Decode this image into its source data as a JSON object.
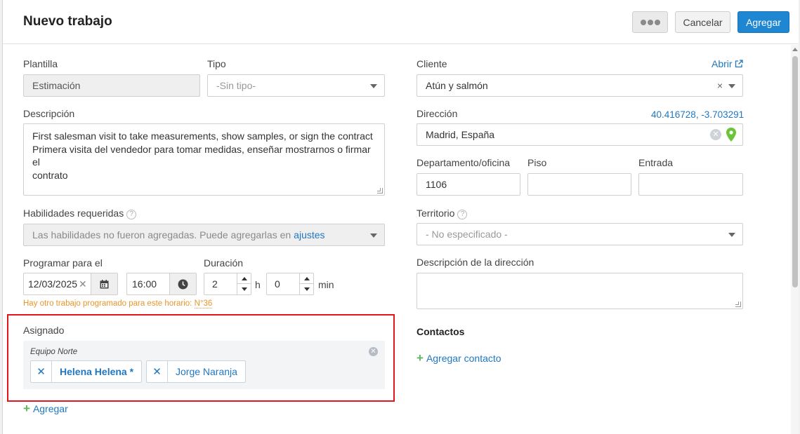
{
  "header": {
    "title": "Nuevo trabajo",
    "cancel_label": "Cancelar",
    "add_label": "Agregar"
  },
  "left": {
    "plantilla": {
      "label": "Plantilla",
      "value": "Estimación"
    },
    "tipo": {
      "label": "Tipo",
      "placeholder": "-Sin tipo-"
    },
    "descripcion": {
      "label": "Descripción",
      "line1": "First salesman visit to take measurements, show samples, or sign the contract",
      "line2": "Primera visita del vendedor para tomar medidas, enseñar mostrarnos o firmar el",
      "line3": "contrato"
    },
    "habilidades": {
      "label": "Habilidades requeridas",
      "placeholder_text": "Las habilidades no fueron agregadas. Puede agregarlas en",
      "placeholder_link": "ajustes"
    },
    "programar": {
      "label": "Programar para el",
      "date": "12/03/2025",
      "time": "16:00"
    },
    "duracion": {
      "label": "Duración",
      "hours": "2",
      "hours_unit": "h",
      "minutes": "0",
      "minutes_unit": "min"
    },
    "warning": {
      "text": "Hay otro trabajo programado para este horario:",
      "link": "N°36"
    },
    "asignado": {
      "label": "Asignado",
      "team": "Equipo Norte",
      "members": [
        "Helena Helena *",
        "Jorge Naranja"
      ],
      "add_label": "Agregar"
    }
  },
  "right": {
    "cliente": {
      "label": "Cliente",
      "open_link": "Abrir",
      "value": "Atún y salmón"
    },
    "direccion": {
      "label": "Dirección",
      "coords": "40.416728, -3.703291",
      "value": "Madrid, España"
    },
    "departamento": {
      "label": "Departamento/oficina",
      "value": "1106"
    },
    "piso": {
      "label": "Piso",
      "value": ""
    },
    "entrada": {
      "label": "Entrada",
      "value": ""
    },
    "territorio": {
      "label": "Territorio",
      "placeholder": "- No especificado -"
    },
    "desc_direccion": {
      "label": "Descripción de la dirección",
      "value": ""
    },
    "contactos": {
      "title": "Contactos",
      "add_label": "Agregar contacto"
    }
  },
  "colors": {
    "primary": "#1f86d1",
    "link": "#1f77c2",
    "warning": "#e8962c",
    "highlight": "#e3141b",
    "add_plus": "#5cb85c",
    "pin": "#6cc43a"
  }
}
